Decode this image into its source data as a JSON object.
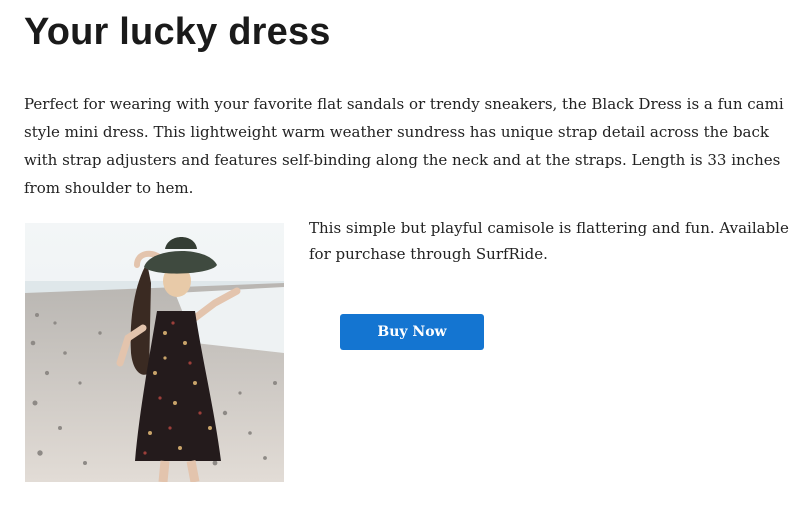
{
  "page": {
    "title": "Your lucky dress",
    "intro": "Perfect for wearing with your favorite flat sandals or trendy sneakers, the Black Dress is a fun cami style mini dress. This lightweight warm weather sundress has unique strap detail across the back with strap adjusters and features self-binding along the neck and at the straps. Length is 33 inches from shoulder to hem."
  },
  "product": {
    "description": "This simple but playful camisole is flattering and fun. Available for purchase through SurfRide.",
    "buy_label": "Buy Now"
  },
  "colors": {
    "accent": "#1475d1",
    "text": "#222222"
  }
}
